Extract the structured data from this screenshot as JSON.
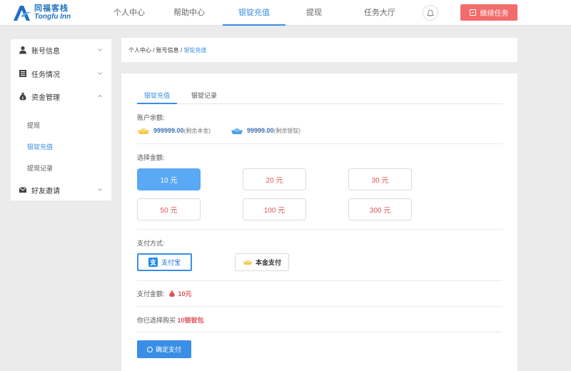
{
  "header": {
    "logo_cn": "同福客栈",
    "logo_en": "Tongfu Inn",
    "nav": [
      {
        "label": "个人中心"
      },
      {
        "label": "帮助中心"
      },
      {
        "label": "银锭充值"
      },
      {
        "label": "提现"
      },
      {
        "label": "任务大厅"
      }
    ],
    "task_button": "继续任务"
  },
  "sidebar": {
    "items": [
      {
        "label": "账号信息"
      },
      {
        "label": "任务情况"
      },
      {
        "label": "资金管理"
      },
      {
        "label": "好友邀请"
      }
    ],
    "sub_items": [
      {
        "label": "提现"
      },
      {
        "label": "银锭充值"
      },
      {
        "label": "提现记录"
      }
    ]
  },
  "breadcrumb": {
    "part1": "个人中心",
    "part2": "账号信息",
    "sep": " / ",
    "current": "银锭充值"
  },
  "main": {
    "tabs": [
      {
        "label": "银锭充值"
      },
      {
        "label": "银锭记录"
      }
    ],
    "balance_label": "账户余额:",
    "balance_principal": "999999.00",
    "balance_principal_note": "(剩余本金)",
    "balance_ingot": "99999.00",
    "balance_ingot_note": "(剩余银锭)",
    "amount_label": "选择金额:",
    "amounts": [
      {
        "label": "10 元"
      },
      {
        "label": "20 元"
      },
      {
        "label": "30 元"
      },
      {
        "label": "50 元"
      },
      {
        "label": "100 元"
      },
      {
        "label": "300 元"
      }
    ],
    "selected_amount_index": 0,
    "payment_label": "支付方式:",
    "payment_methods": [
      {
        "label": "支付宝",
        "icon": "支"
      },
      {
        "label": "本金支付"
      }
    ],
    "pay_amount_label": "支付金额:",
    "pay_amount_value": "10元",
    "chosen_prefix": "你已选择购买 ",
    "chosen_value": "10银锭包",
    "confirm_label": "确定支付"
  },
  "colors": {
    "accent": "#3a8ee6",
    "danger": "#e05555",
    "task_button": "#f36c6c",
    "selected_amount": "#5aa9f4"
  }
}
